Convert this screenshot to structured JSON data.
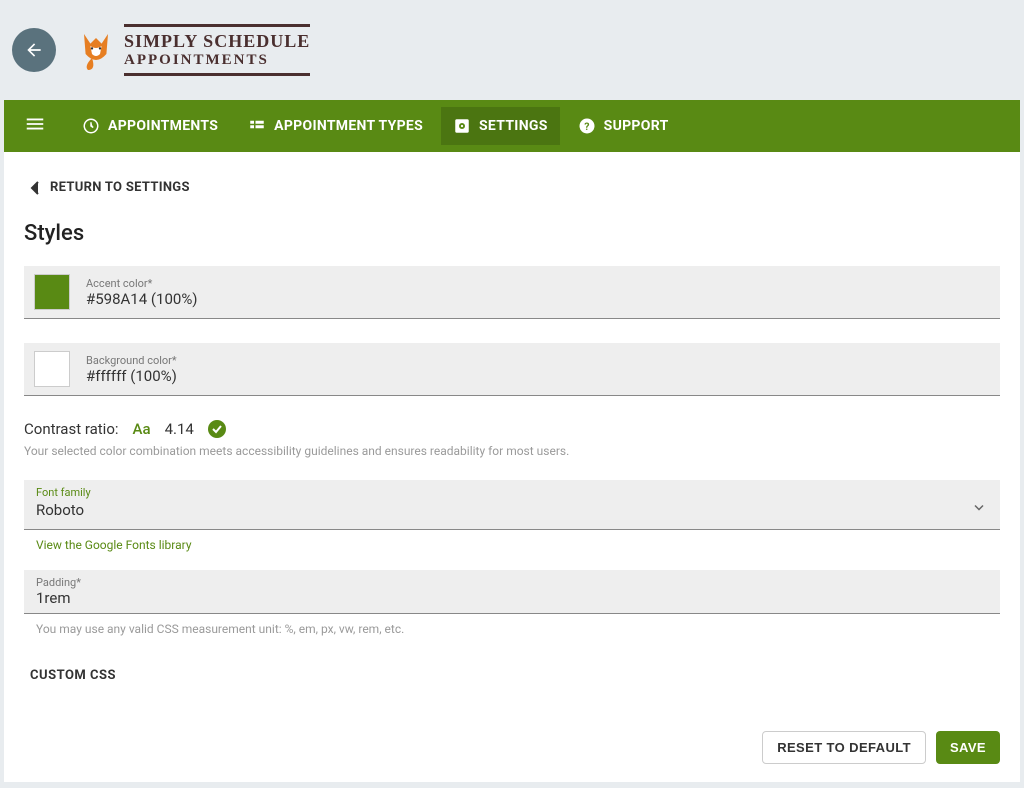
{
  "brand": {
    "line1": "SIMPLY SCHEDULE",
    "line2": "APPOINTMENTS"
  },
  "nav": {
    "appointments": "APPOINTMENTS",
    "appointment_types": "APPOINTMENT TYPES",
    "settings": "SETTINGS",
    "support": "SUPPORT"
  },
  "breadcrumb": {
    "return": "RETURN TO SETTINGS"
  },
  "page": {
    "title": "Styles"
  },
  "accent": {
    "label": "Accent color*",
    "value": "#598A14 (100%)",
    "swatch": "#598A14"
  },
  "background": {
    "label": "Background color*",
    "value": "#ffffff (100%)",
    "swatch": "#ffffff"
  },
  "contrast": {
    "label": "Contrast ratio:",
    "sample": "Aa",
    "value": "4.14",
    "description": "Your selected color combination meets accessibility guidelines and ensures readability for most users."
  },
  "font": {
    "label": "Font family",
    "value": "Roboto",
    "link": "View the Google Fonts library"
  },
  "padding": {
    "label": "Padding*",
    "value": "1rem",
    "hint": "You may use any valid CSS measurement unit: %, em, px, vw, rem, etc."
  },
  "customcss": {
    "label": "CUSTOM CSS"
  },
  "buttons": {
    "reset": "RESET TO DEFAULT",
    "save": "SAVE"
  }
}
